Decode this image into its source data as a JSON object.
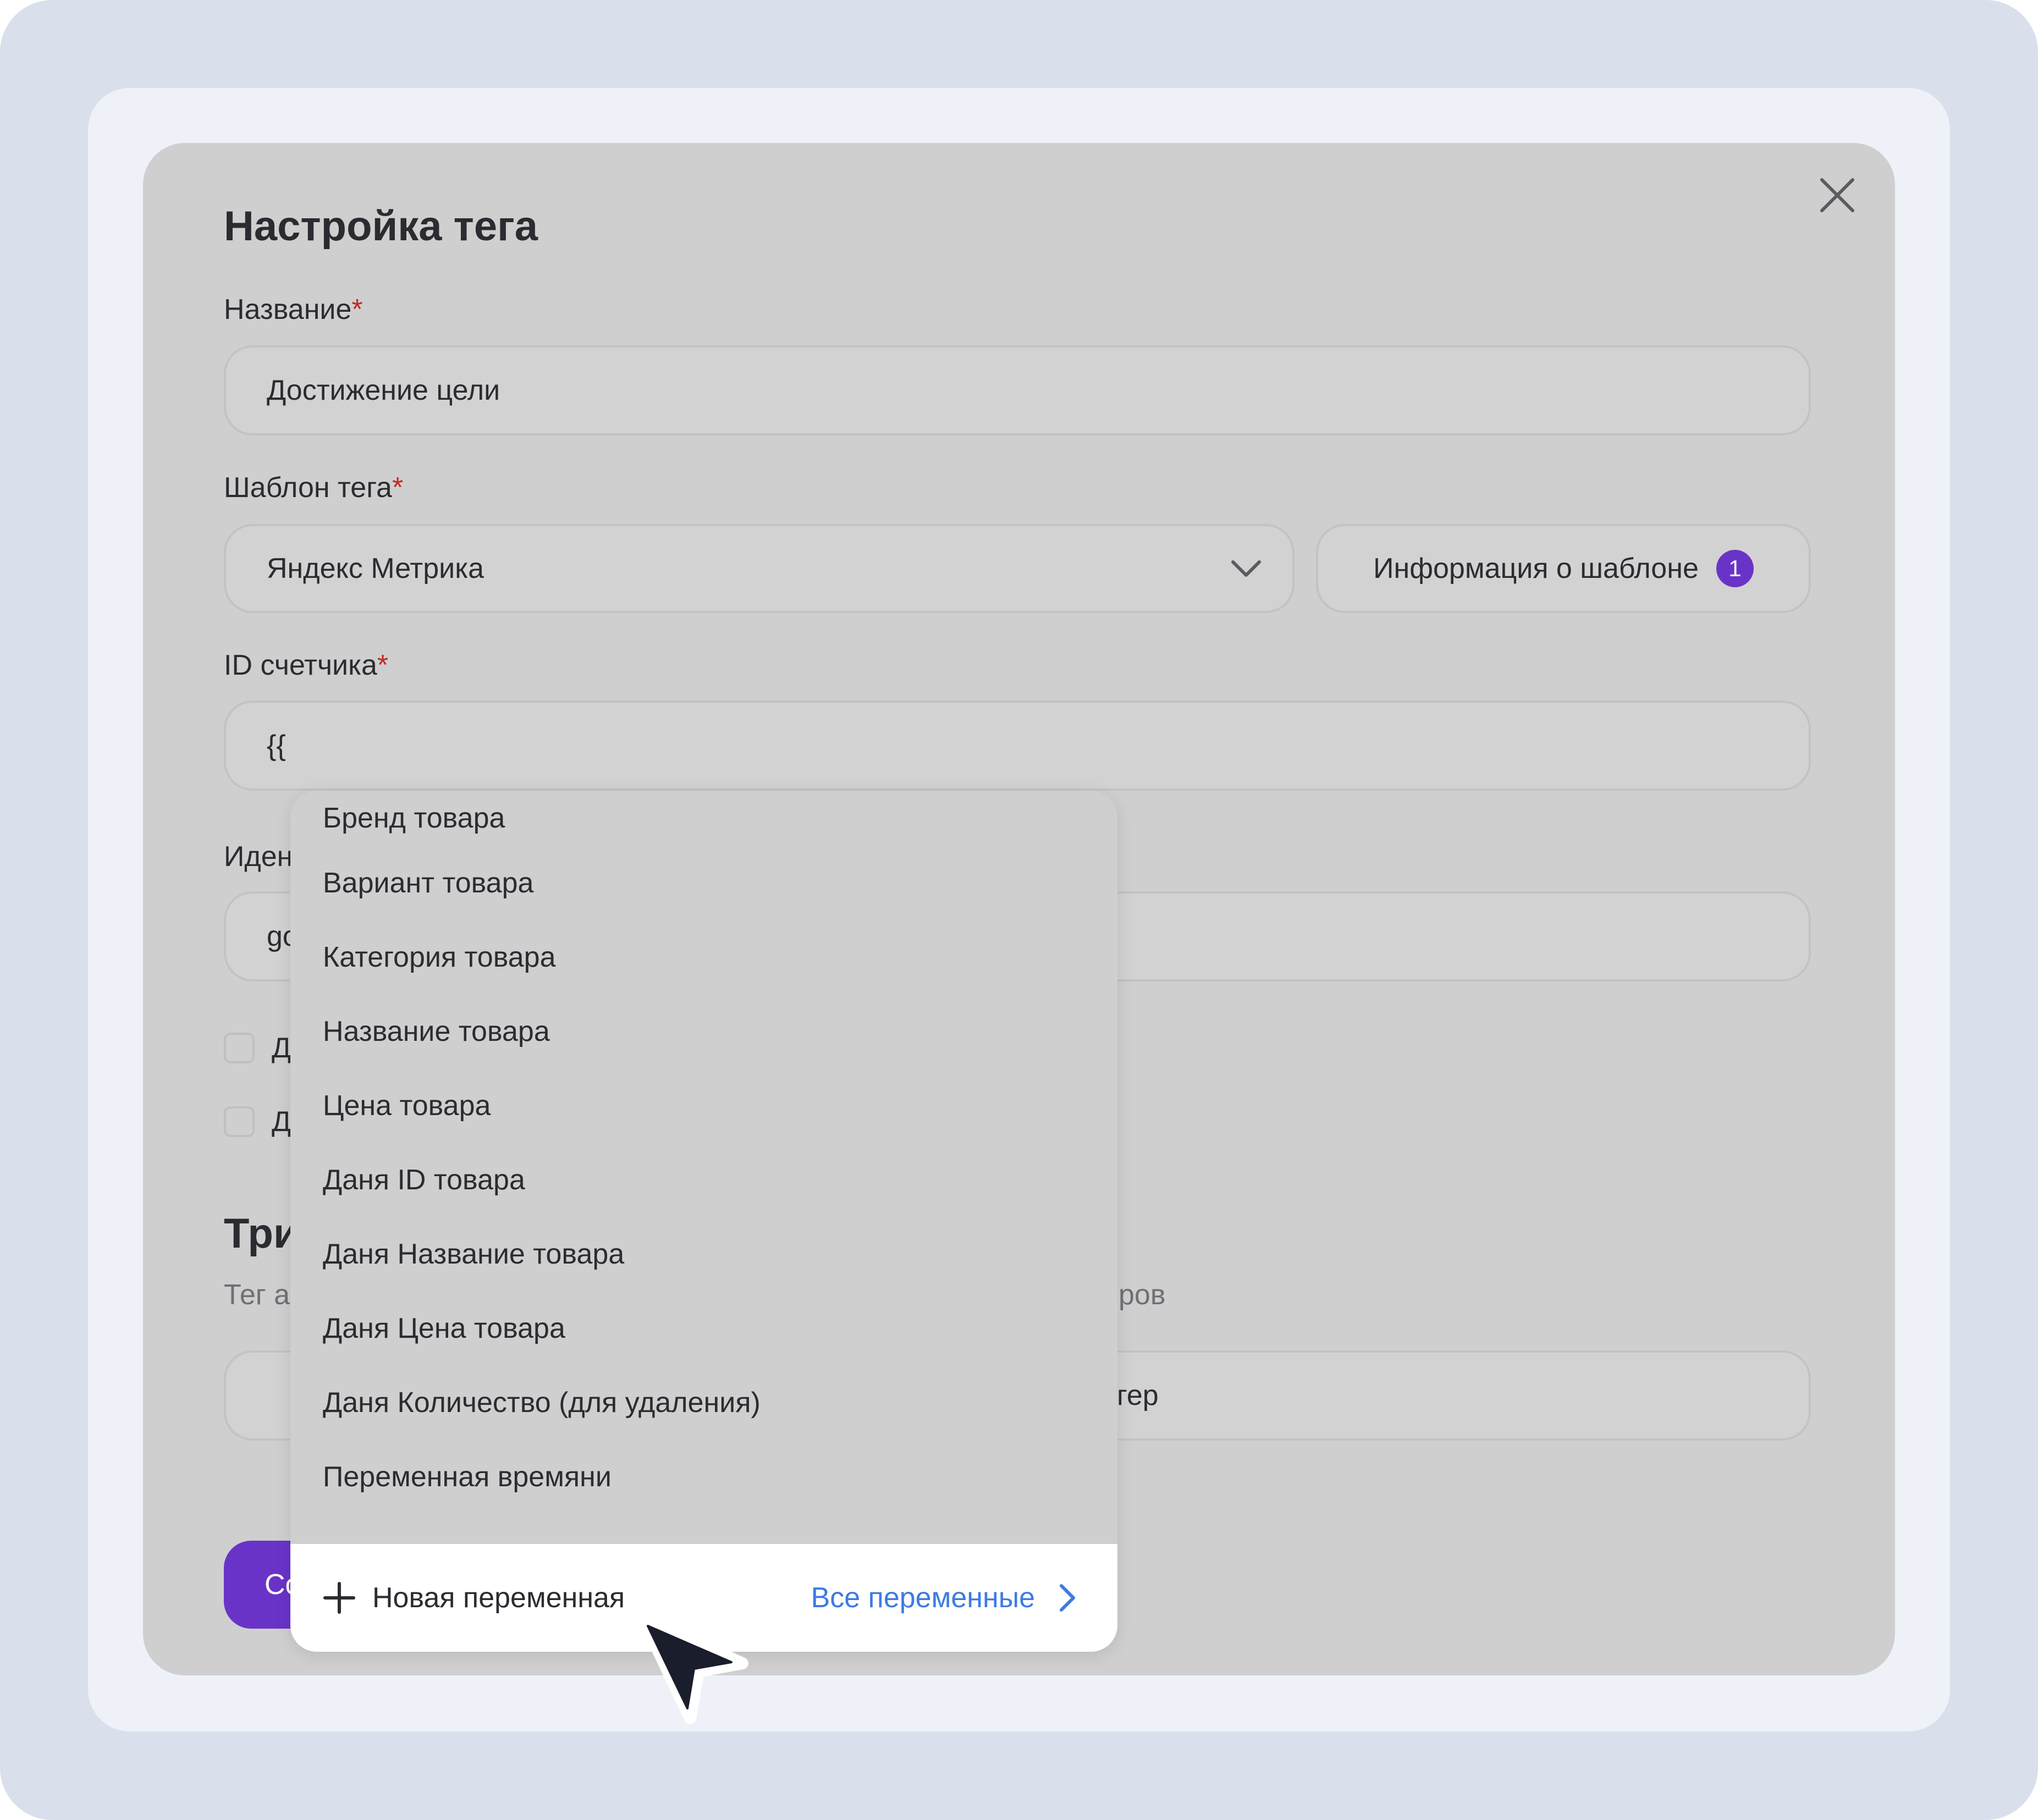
{
  "dialog": {
    "title": "Настройка тега",
    "name_field": {
      "label": "Название",
      "required_mark": "*",
      "value": "Достижение цели"
    },
    "template_field": {
      "label": "Шаблон тега",
      "required_mark": "*",
      "value": "Яндекс Метрика"
    },
    "template_info_button": {
      "label": "Информация о шаблоне",
      "badge": "1"
    },
    "counter_id_field": {
      "label": "ID счетчика",
      "required_mark": "*",
      "value": "{{"
    },
    "partial_behind_dropdown": {
      "identifier_label": "Иден",
      "identifier_value": "go",
      "checkbox1_label": "Д",
      "checkbox2_label": "Д",
      "section_title": "Три",
      "section_desc_left": "Тег а",
      "section_desc_right": "ров",
      "trigger_field_value": "гер",
      "submit_label": "Со"
    }
  },
  "variable_dropdown": {
    "items": [
      "Бренд товара",
      "Вариант товара",
      "Категория товара",
      "Название товара",
      "Цена товара",
      "Даня ID товара",
      "Даня Название товара",
      "Даня Цена товара",
      "Даня Количество (для удаления)",
      "Переменная времяни"
    ],
    "new_variable_label": "Новая переменная",
    "all_variables_label": "Все переменные"
  },
  "colors": {
    "accent": "#6a33c8",
    "link": "#3e7be0",
    "required": "#c62828",
    "overlay": "#cfcfcf",
    "page_bg": "#d9e0ec"
  },
  "icons": {
    "close": "close-icon",
    "chevron": "chevron-down-icon",
    "plus": "plus-icon",
    "chevron_right": "chevron-right-icon",
    "cursor": "mouse-cursor-icon"
  }
}
